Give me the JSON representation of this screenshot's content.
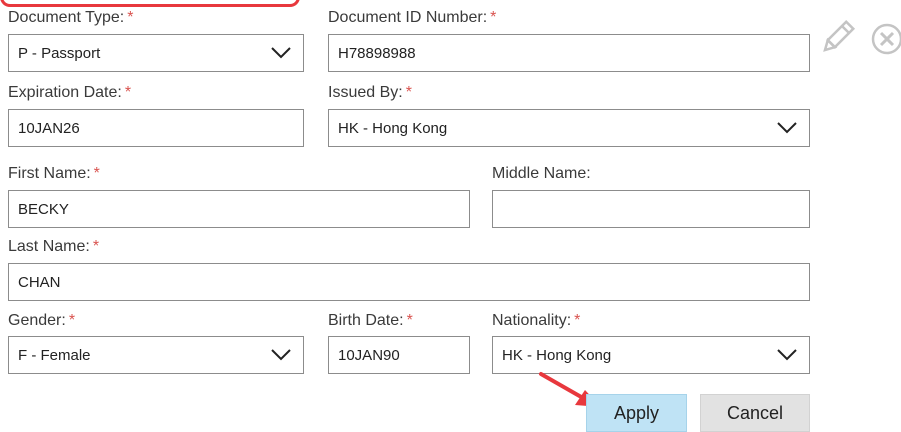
{
  "required_marker": "*",
  "document_type": {
    "label": "Document Type:",
    "value": "P - Passport"
  },
  "document_id": {
    "label": "Document ID Number:",
    "value": "H78898988"
  },
  "expiration_date": {
    "label": "Expiration Date:",
    "value": "10JAN26"
  },
  "issued_by": {
    "label": "Issued By:",
    "value": "HK - Hong Kong"
  },
  "first_name": {
    "label": "First Name:",
    "value": "BECKY"
  },
  "middle_name": {
    "label": "Middle Name:",
    "value": ""
  },
  "last_name": {
    "label": "Last Name:",
    "value": "CHAN"
  },
  "gender": {
    "label": "Gender:",
    "value": "F - Female"
  },
  "birth_date": {
    "label": "Birth Date:",
    "value": "10JAN90"
  },
  "nationality": {
    "label": "Nationality:",
    "value": "HK - Hong Kong"
  },
  "actions": {
    "apply_label": "Apply",
    "cancel_label": "Cancel"
  },
  "icons": {
    "edit": "pencil-icon",
    "remove": "close-circle-icon",
    "annotation": "red-arrow"
  },
  "colors": {
    "highlight": "#e8383d",
    "required": "#d9534f",
    "apply_bg": "#bfe3f5",
    "cancel_bg": "#e2e2e2",
    "icon": "#c4c4c4"
  }
}
